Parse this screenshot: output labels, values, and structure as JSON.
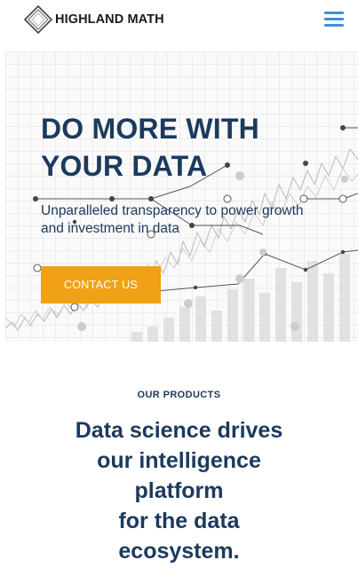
{
  "header": {
    "brand": "HIGHLAND MATH",
    "logo_icon": "diamond-logo-icon",
    "menu_icon": "hamburger-menu-icon",
    "menu_color": "#3d8fd6"
  },
  "hero": {
    "title_line1": "DO MORE WITH",
    "title_line2": "YOUR DATA",
    "subtitle": "Unparalleled transparency to power growth and investment in data",
    "cta_label": "CONTACT US",
    "cta_color": "#f0a116",
    "text_color": "#1b3a5c"
  },
  "products": {
    "label": "OUR PRODUCTS",
    "heading_line1": "Data science drives",
    "heading_line2": "our intelligence",
    "heading_line3": "platform",
    "heading_line4": "for the data",
    "heading_line5": "ecosystem."
  }
}
